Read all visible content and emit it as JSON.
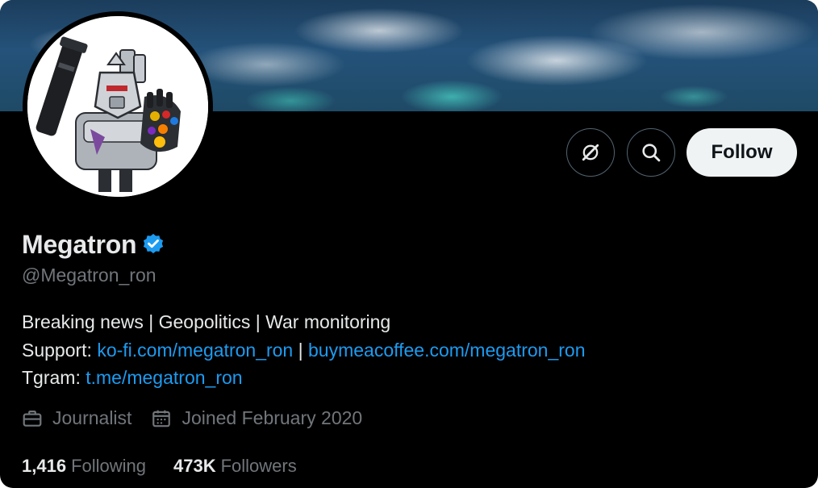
{
  "profile": {
    "display_name": "Megatron",
    "handle": "@Megatron_ron",
    "verified": true,
    "bio": {
      "line1": "Breaking news | Geopolitics | War monitoring",
      "support_label": "Support:",
      "support_link1": "ko-fi.com/megatron_ron",
      "separator": " | ",
      "support_link2": "buymeacoffee.com/megatron_ron",
      "tgram_label": "Tgram:",
      "tgram_link": "t.me/megatron_ron"
    },
    "profession": "Journalist",
    "joined": "Joined February 2020",
    "following_count": "1,416",
    "following_label": "Following",
    "followers_count": "473K",
    "followers_label": "Followers"
  },
  "actions": {
    "follow_label": "Follow",
    "grok_icon": "grok-icon",
    "search_icon": "search-icon"
  },
  "colors": {
    "background": "#000000",
    "text_primary": "#e7e9ea",
    "text_secondary": "#71767b",
    "link": "#1d9bf0",
    "verified": "#1d9bf0",
    "follow_button_bg": "#eff3f4",
    "button_border": "#536471"
  }
}
